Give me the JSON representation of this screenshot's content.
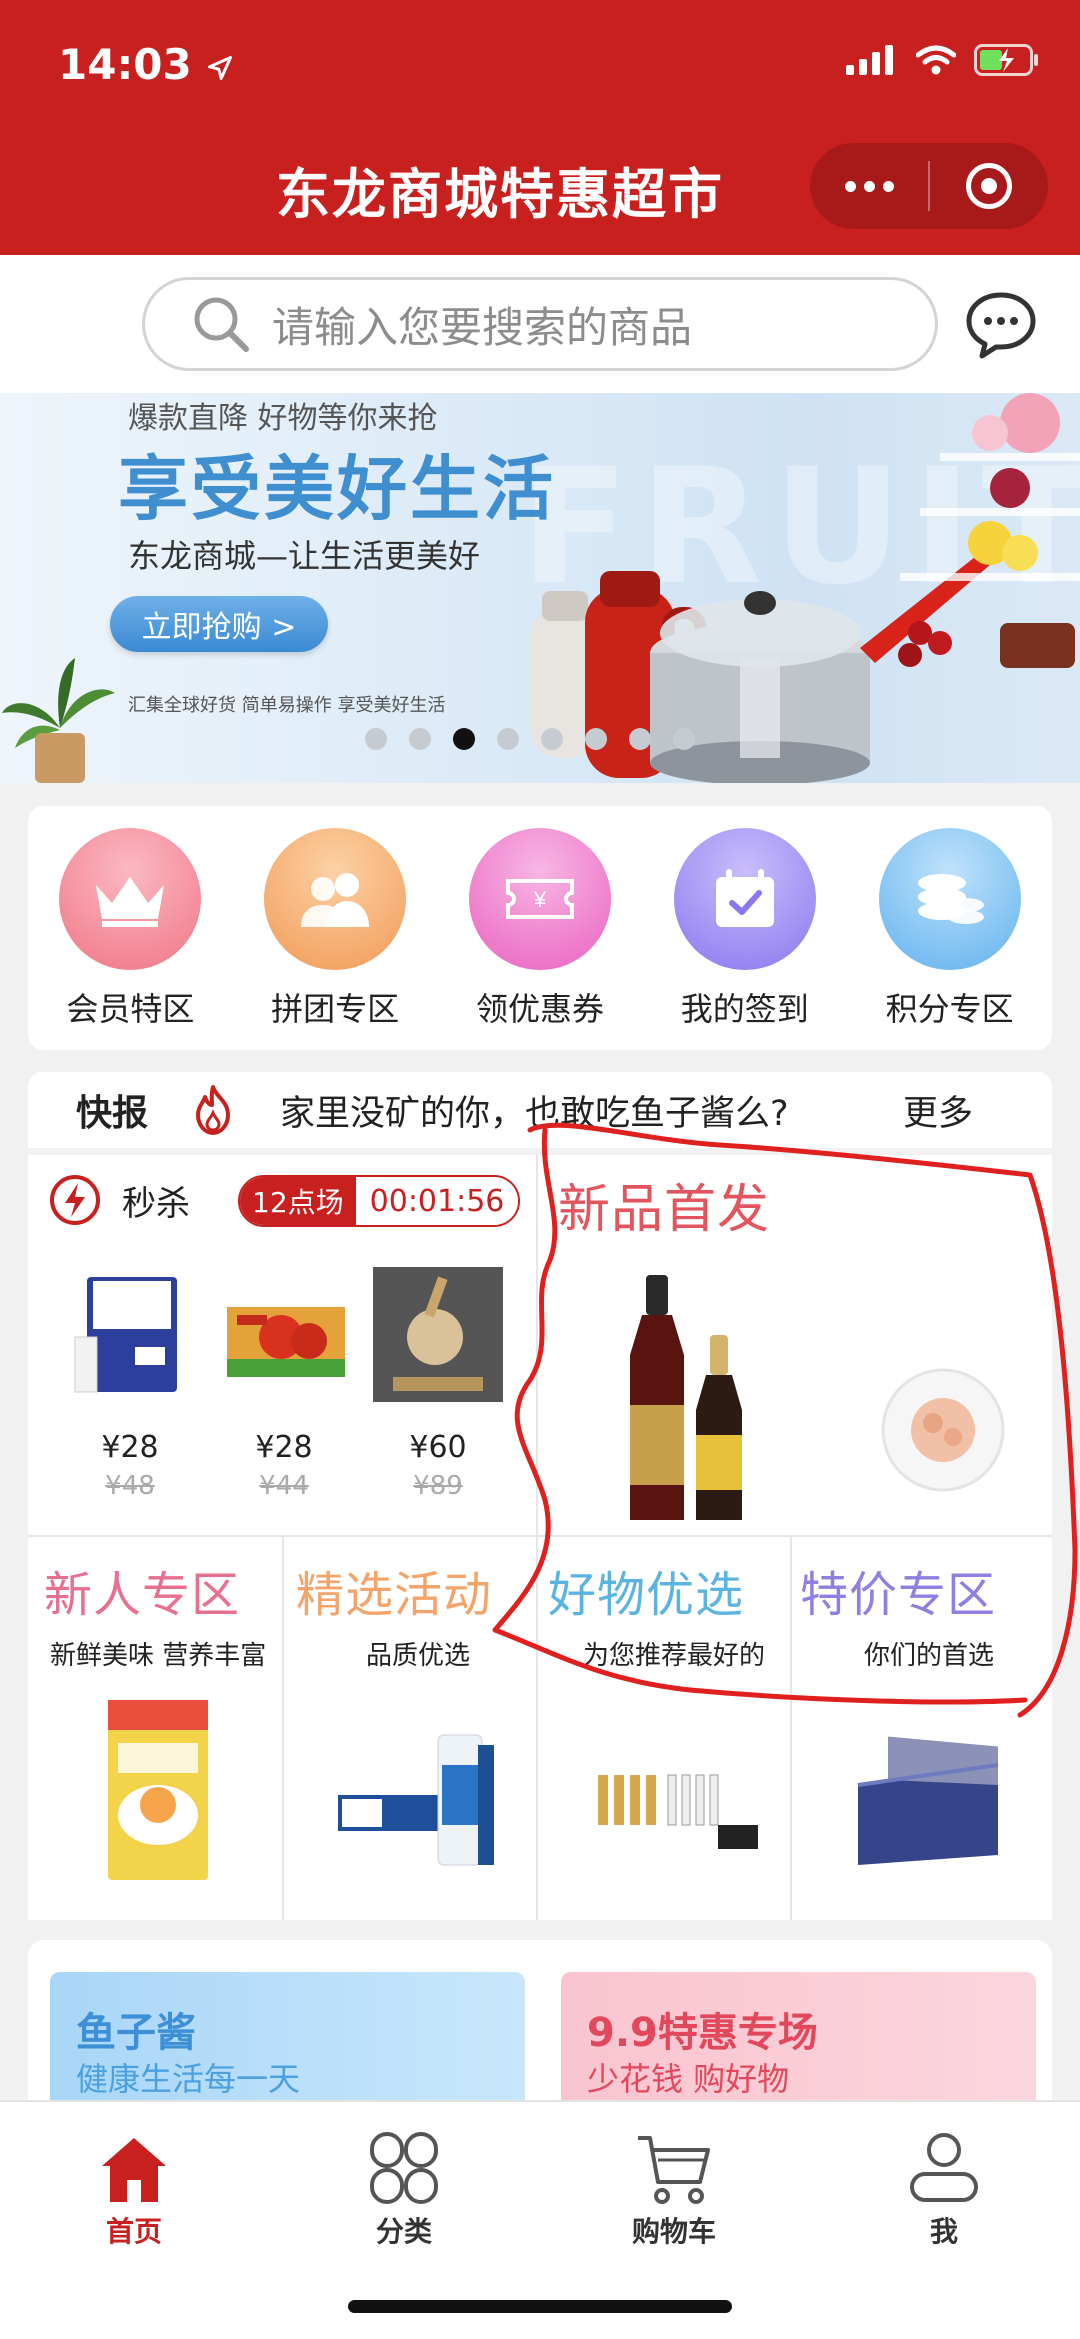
{
  "status_bar": {
    "time": "14:03"
  },
  "header": {
    "title": "东龙商城特惠超市"
  },
  "search": {
    "placeholder": "请输入您要搜索的商品"
  },
  "banner": {
    "tagline": "爆款直降 好物等你来抢",
    "headline": "享受美好生活",
    "subline": "东龙商城—让生活更美好",
    "button": "立即抢购 >",
    "small": "汇集全球好货  简单易操作  享受美好生活",
    "watermark": "FRUIT",
    "active_slide": 3,
    "total_slides": 8
  },
  "quick_menu": [
    {
      "label": "会员特区",
      "icon": "crown-icon",
      "color": "#f37b8a"
    },
    {
      "label": "拼团专区",
      "icon": "group-icon",
      "color": "#f4a15c"
    },
    {
      "label": "领优惠券",
      "icon": "coupon-icon",
      "color": "#ef6cc4"
    },
    {
      "label": "我的签到",
      "icon": "calendar-check-icon",
      "color": "#8f7cf0"
    },
    {
      "label": "积分专区",
      "icon": "coins-icon",
      "color": "#6db8f0"
    }
  ],
  "news": {
    "tag": "快报",
    "message": "家里没矿的你，也敢吃鱼子酱么?",
    "more": "更多"
  },
  "seckill": {
    "title": "秒杀",
    "session": "12点场",
    "countdown": "00:01:56",
    "products": [
      {
        "price": "¥28",
        "original": "¥48"
      },
      {
        "price": "¥28",
        "original": "¥44"
      },
      {
        "price": "¥60",
        "original": "¥89"
      }
    ]
  },
  "new_products": {
    "title": "新品首发"
  },
  "sections": [
    {
      "title": "新人专区",
      "subtitle": "新鲜美味 营养丰富",
      "color": "#e8708f"
    },
    {
      "title": "精选活动",
      "subtitle": "品质优选",
      "color": "#f2a46a"
    },
    {
      "title": "好物优选",
      "subtitle": "为您推荐最好的",
      "color": "#5bb4e0"
    },
    {
      "title": "特价专区",
      "subtitle": "你们的首选",
      "color": "#8f7fe0"
    }
  ],
  "promos": [
    {
      "title": "鱼子酱",
      "subtitle": "健康生活每一天"
    },
    {
      "title": "9.9特惠专场",
      "subtitle": "少花钱 购好物"
    }
  ],
  "tabs": [
    {
      "label": "首页",
      "icon": "home-icon"
    },
    {
      "label": "分类",
      "icon": "category-icon"
    },
    {
      "label": "购物车",
      "icon": "cart-icon"
    },
    {
      "label": "我",
      "icon": "user-icon"
    }
  ],
  "colors": {
    "brand": "#c8201e",
    "annotation": "#e0201e"
  }
}
